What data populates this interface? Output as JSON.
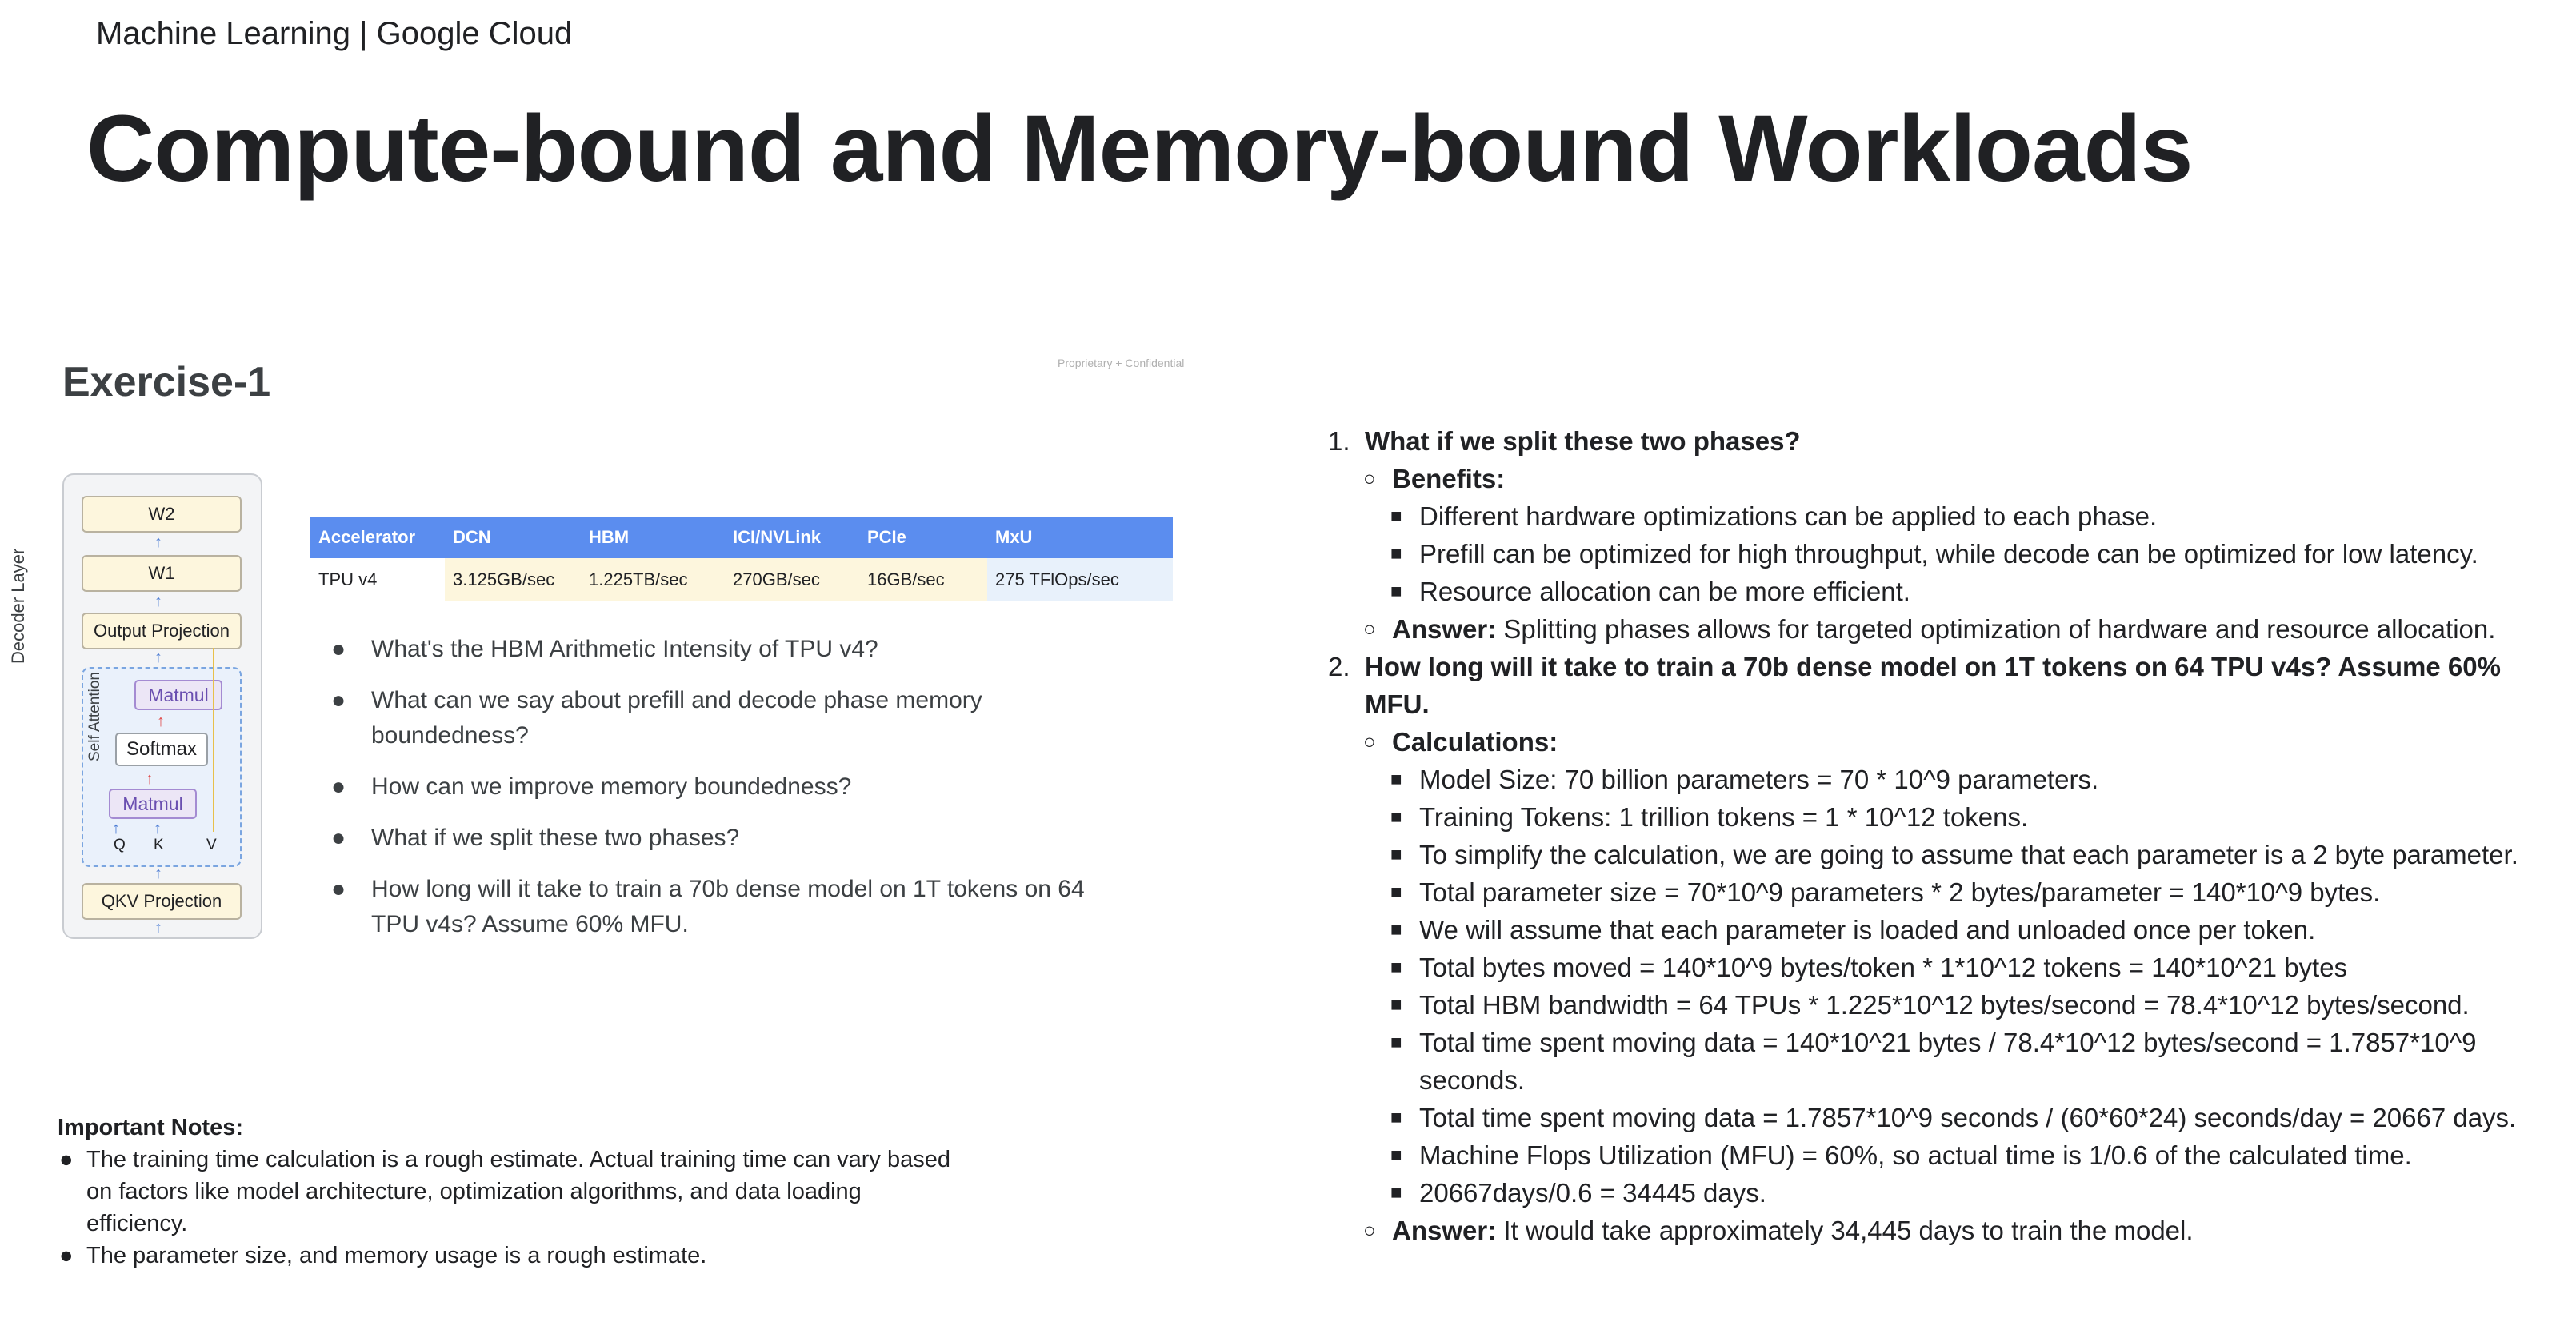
{
  "header": {
    "brand": "Machine Learning | Google Cloud",
    "title": "Compute-bound and Memory-bound Workloads"
  },
  "slide": {
    "title": "Exercise-1",
    "confidential": "Proprietary + Confidential",
    "diagram": {
      "decoder_label": "Decoder Layer",
      "self_attention_label": "Self Attention",
      "w2": "W2",
      "w1": "W1",
      "output_projection": "Output Projection",
      "matmul_top": "Matmul",
      "softmax": "Softmax",
      "matmul_bottom": "Matmul",
      "q": "Q",
      "k": "K",
      "v": "V",
      "qkv_projection": "QKV Projection"
    },
    "table": {
      "headers": [
        "Accelerator",
        "DCN",
        "HBM",
        "ICI/NVLink",
        "PCIe",
        "MxU"
      ],
      "rows": [
        [
          "TPU v4",
          "3.125GB/sec",
          "1.225TB/sec",
          "270GB/sec",
          "16GB/sec",
          "275 TFlOps/sec"
        ]
      ]
    },
    "questions": [
      "What's the HBM Arithmetic Intensity of TPU v4?",
      "What can we say about prefill and decode phase memory boundedness?",
      "How can we improve memory boundedness?",
      "What if we split these two phases?",
      "How long will it take to train a 70b dense model on 1T tokens on 64 TPU v4s? Assume 60% MFU."
    ]
  },
  "notes": {
    "title": "Important Notes:",
    "items": [
      "The training time calculation is a rough estimate. Actual training time can vary based on factors like model architecture, optimization algorithms, and data loading efficiency.",
      "The parameter size, and memory usage is a rough estimate."
    ]
  },
  "answers": {
    "q1": {
      "num": "1.",
      "question": "What if we split these two phases?",
      "benefits_label": "Benefits:",
      "benefits": [
        "Different hardware optimizations can be applied to each phase.",
        "Prefill can be optimized for high throughput, while decode can be optimized for low latency.",
        "Resource allocation can be more efficient."
      ],
      "answer_label": "Answer:",
      "answer": "Splitting phases allows for targeted optimization of hardware and resource allocation."
    },
    "q2": {
      "num": "2.",
      "question": "How long will it take to train a 70b dense model on 1T tokens on 64 TPU v4s? Assume 60% MFU.",
      "calc_label": "Calculations:",
      "calcs": [
        "Model Size: 70 billion parameters = 70 * 10^9 parameters.",
        "Training Tokens: 1 trillion tokens = 1 * 10^12 tokens.",
        "To simplify the calculation, we are going to assume that each parameter is a 2 byte parameter.",
        "Total parameter size = 70*10^9 parameters * 2 bytes/parameter = 140*10^9 bytes.",
        "We will assume that each parameter is loaded and unloaded once per token.",
        "Total bytes moved = 140*10^9 bytes/token * 1*10^12 tokens = 140*10^21 bytes",
        "Total HBM bandwidth = 64 TPUs * 1.225*10^12 bytes/second = 78.4*10^12 bytes/second.",
        "Total time spent moving data = 140*10^21 bytes / 78.4*10^12 bytes/second = 1.7857*10^9 seconds.",
        "Total time spent moving data = 1.7857*10^9 seconds / (60*60*24) seconds/day = 20667 days.",
        "Machine Flops Utilization (MFU) = 60%, so actual time is 1/0.6 of the calculated time.",
        "20667days/0.6 = 34445 days."
      ],
      "answer_label": "Answer:",
      "answer": "It would take approximately 34,445 days to train the model."
    }
  }
}
